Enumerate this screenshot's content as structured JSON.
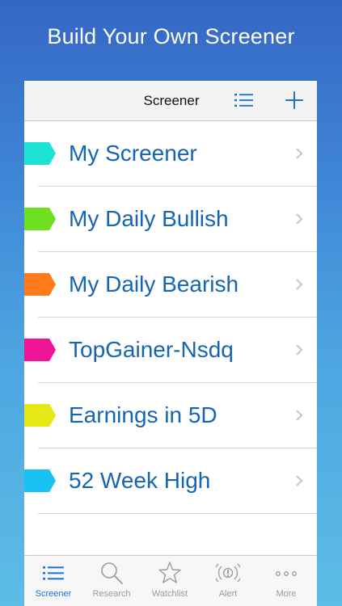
{
  "promo": {
    "title": "Build Your Own Screener"
  },
  "navbar": {
    "title": "Screener",
    "list_icon": "list-icon",
    "add_icon": "plus-icon",
    "accent": "#1a73d9"
  },
  "screeners": [
    {
      "name": "My Screener",
      "color": "#1de3d6"
    },
    {
      "name": "My Daily Bullish",
      "color": "#6fe01f"
    },
    {
      "name": "My Daily Bearish",
      "color": "#ff7a1a"
    },
    {
      "name": "TopGainer-Nsdq",
      "color": "#ef1596"
    },
    {
      "name": "Earnings in 5D",
      "color": "#e5e812"
    },
    {
      "name": "52 Week High",
      "color": "#18c2f2"
    }
  ],
  "tabs": [
    {
      "label": "Screener",
      "icon": "list-icon",
      "active": true
    },
    {
      "label": "Research",
      "icon": "search-icon",
      "active": false
    },
    {
      "label": "Watchlist",
      "icon": "star-icon",
      "active": false
    },
    {
      "label": "Alert",
      "icon": "alert-icon",
      "active": false
    },
    {
      "label": "More",
      "icon": "more-icon",
      "active": false
    }
  ]
}
